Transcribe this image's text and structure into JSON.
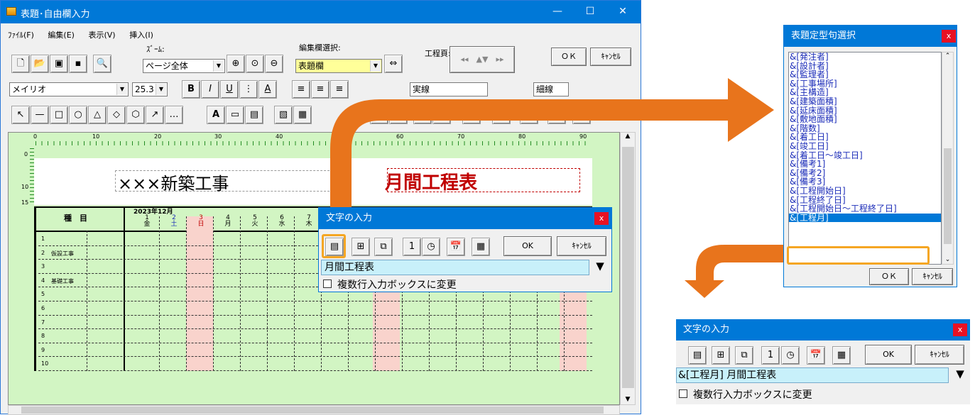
{
  "main_window": {
    "title": "表題･自由欄入力",
    "controls": {
      "minimize": "—",
      "maximize": "☐",
      "close": "✕"
    },
    "menu": [
      "ﾌｧｲﾙ(F)",
      "編集(E)",
      "表示(V)",
      "挿入(I)"
    ],
    "toolbar1": {
      "zoom_label": "ｽﾞｰﾑ:",
      "zoom_value": "ページ全体",
      "edit_area_label": "編集欄選択:",
      "edit_area_value": "表題欄",
      "process_page_label": "工程頁:",
      "ok_label": "ＯＫ",
      "cancel_label": "ｷｬﾝｾﾙ"
    },
    "toolbar2": {
      "font_value": "メイリオ",
      "size_value": "25.3",
      "color_value": "実線",
      "width_value": "細線"
    },
    "canvas": {
      "title_text": "×××新築工事",
      "chart_title": "月間工程表",
      "ruler_ticks": [
        "0",
        "10",
        "20",
        "30",
        "40",
        "50",
        "60",
        "70",
        "80",
        "90"
      ],
      "vruler_ticks": [
        "0",
        "10",
        "15"
      ],
      "date_header": "2023年12月",
      "col_head": "種　目",
      "days": [
        {
          "d": "1",
          "w": "金"
        },
        {
          "d": "2",
          "w": "土"
        },
        {
          "d": "3",
          "w": "日"
        },
        {
          "d": "4",
          "w": "月"
        },
        {
          "d": "5",
          "w": "火"
        },
        {
          "d": "6",
          "w": "水"
        },
        {
          "d": "7",
          "w": "木"
        }
      ],
      "rows": [
        {
          "n": "1",
          "label": ""
        },
        {
          "n": "2",
          "label": "仮設工事"
        },
        {
          "n": "3",
          "label": ""
        },
        {
          "n": "4",
          "label": "基礎工事"
        },
        {
          "n": "5",
          "label": ""
        },
        {
          "n": "6",
          "label": ""
        },
        {
          "n": "7",
          "label": ""
        },
        {
          "n": "8",
          "label": ""
        },
        {
          "n": "9",
          "label": ""
        },
        {
          "n": "10",
          "label": ""
        }
      ]
    }
  },
  "inner_text_dialog": {
    "title": "文字の入力",
    "ok_label": "OK",
    "cancel_label": "ｷｬﾝｾﾙ",
    "input_value": "月間工程表",
    "checkbox_label": "複数行入力ボックスに変更"
  },
  "phrase_dialog": {
    "title": "表題定型句選択",
    "items": [
      "&[発注者]",
      "&[設計者]",
      "&[監理者]",
      "&[工事場所]",
      "&[主構造]",
      "&[建築面積]",
      "&[延床面積]",
      "&[敷地面積]",
      "&[階数]",
      "&[着工日]",
      "&[竣工日]",
      "&[着工日～竣工日]",
      "&[備考1]",
      "&[備考2]",
      "&[備考3]",
      "&[工程開始日]",
      "&[工程終了日]",
      "&[工程開始日～工程終了日]",
      "&[工程月]"
    ],
    "selected_item": "&[工程月]",
    "ok_label": "ＯＫ",
    "cancel_label": "ｷｬﾝｾﾙ"
  },
  "result_text_dialog": {
    "title": "文字の入力",
    "ok_label": "OK",
    "cancel_label": "ｷｬﾝｾﾙ",
    "input_value": "&[工程月] 月間工程表",
    "checkbox_label": "複数行入力ボックスに変更"
  },
  "colors": {
    "accent": "#0078d7",
    "arrow": "#e8741c",
    "highlight": "#f5a623",
    "chart_title": "#c00000",
    "sunday": "#f9d3cc",
    "canvas": "#d2f5c3"
  }
}
